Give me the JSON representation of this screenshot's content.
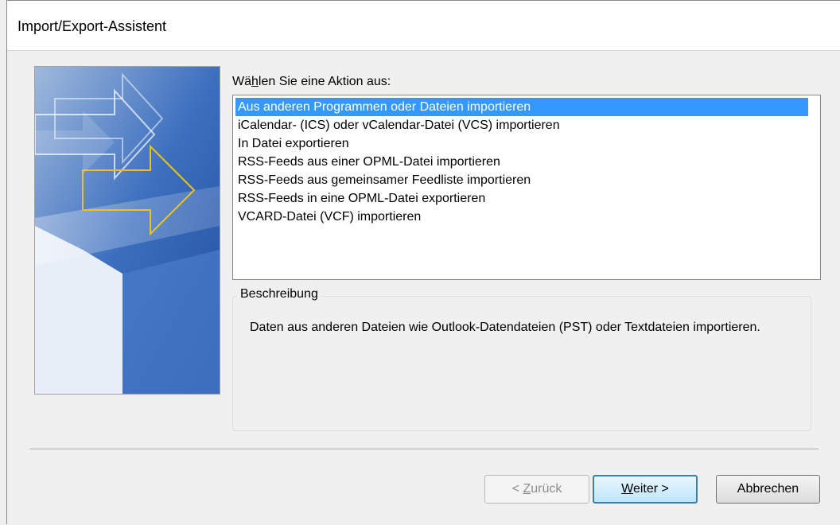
{
  "window": {
    "title": "Import/Export-Assistent"
  },
  "prompt": {
    "label_pre": "Wä",
    "label_accel": "h",
    "label_post": "len Sie eine Aktion aus:"
  },
  "actions": [
    {
      "label": "Aus anderen Programmen oder Dateien importieren",
      "selected": true
    },
    {
      "label": "iCalendar- (ICS) oder vCalendar-Datei (VCS) importieren",
      "selected": false
    },
    {
      "label": "In Datei exportieren",
      "selected": false
    },
    {
      "label": "RSS-Feeds aus einer OPML-Datei importieren",
      "selected": false
    },
    {
      "label": "RSS-Feeds aus gemeinsamer Feedliste importieren",
      "selected": false
    },
    {
      "label": "RSS-Feeds in eine OPML-Datei exportieren",
      "selected": false
    },
    {
      "label": "VCARD-Datei (VCF) importieren",
      "selected": false
    }
  ],
  "description": {
    "label": "Beschreibung",
    "text": "Daten aus anderen Dateien wie Outlook-Datendateien (PST) oder Textdateien importieren."
  },
  "buttons": {
    "back": {
      "pre": "< ",
      "accel": "Z",
      "post": "urück"
    },
    "next": {
      "pre": "",
      "accel": "W",
      "post": "eiter >"
    },
    "cancel": {
      "label": "Abbrechen"
    }
  },
  "colors": {
    "selection": "#3399ff",
    "banner_blue": "#2a5aa8",
    "arrow_yellow": "#f0c020"
  }
}
